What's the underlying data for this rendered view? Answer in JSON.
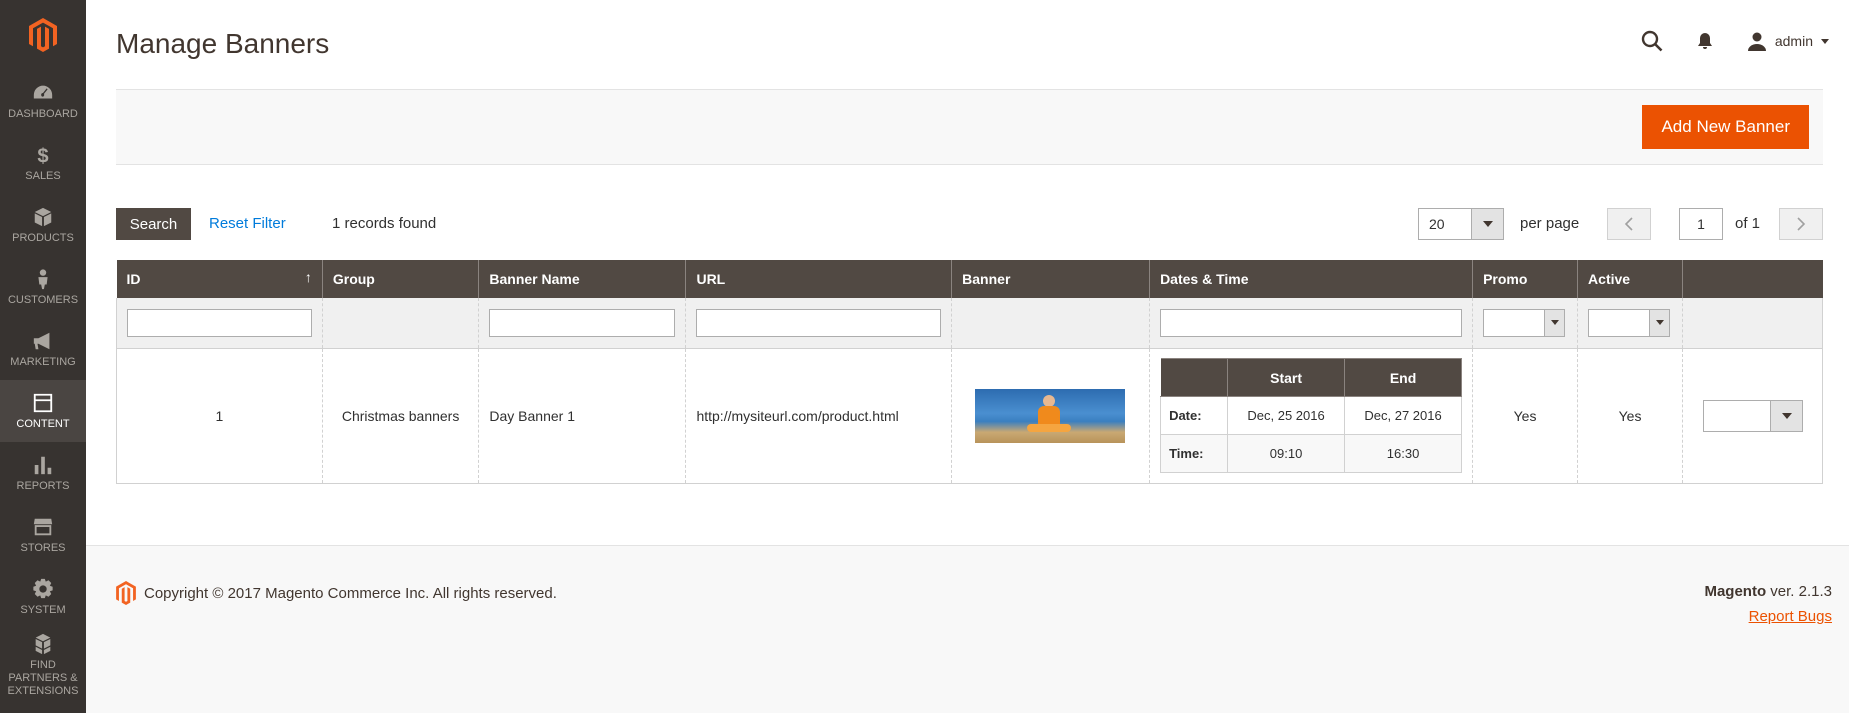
{
  "sidebar": {
    "items": [
      {
        "label": "DASHBOARD",
        "icon": "dashboard-icon"
      },
      {
        "label": "SALES",
        "icon": "dollar-icon"
      },
      {
        "label": "PRODUCTS",
        "icon": "box-icon"
      },
      {
        "label": "CUSTOMERS",
        "icon": "person-icon"
      },
      {
        "label": "MARKETING",
        "icon": "megaphone-icon"
      },
      {
        "label": "CONTENT",
        "icon": "content-icon",
        "active": true
      },
      {
        "label": "REPORTS",
        "icon": "bar-chart-icon"
      },
      {
        "label": "STORES",
        "icon": "store-icon"
      },
      {
        "label": "SYSTEM",
        "icon": "gear-icon"
      },
      {
        "label": "FIND PARTNERS & EXTENSIONS",
        "icon": "cubes-icon"
      }
    ]
  },
  "header": {
    "title": "Manage Banners",
    "user": "admin"
  },
  "actions": {
    "add_button": "Add New Banner"
  },
  "toolbar": {
    "search_label": "Search",
    "reset_label": "Reset Filter",
    "records_text": "1 records found",
    "per_page_value": "20",
    "per_page_label": "per page",
    "page_value": "1",
    "page_of": "of 1"
  },
  "grid": {
    "columns": [
      "ID",
      "Group",
      "Banner Name",
      "URL",
      "Banner",
      "Dates & Time",
      "Promo",
      "Active"
    ],
    "rows": [
      {
        "id": "1",
        "group": "Christmas banners",
        "name": "Day Banner 1",
        "url": "http://mysiteurl.com/product.html",
        "dates": {
          "start_header": "Start",
          "end_header": "End",
          "date_label": "Date:",
          "start_date": "Dec, 25 2016",
          "end_date": "Dec, 27 2016",
          "time_label": "Time:",
          "start_time": "09:10",
          "end_time": "16:30"
        },
        "promo": "Yes",
        "active": "Yes"
      }
    ]
  },
  "footer": {
    "copyright": "Copyright © 2017 Magento Commerce Inc. All rights reserved.",
    "brand": "Magento",
    "version": " ver. 2.1.3",
    "report_bugs": "Report Bugs"
  },
  "colors": {
    "accent": "#eb5202",
    "sidebar_bg": "#373330",
    "header_bg": "#514943",
    "link": "#007bdb"
  }
}
